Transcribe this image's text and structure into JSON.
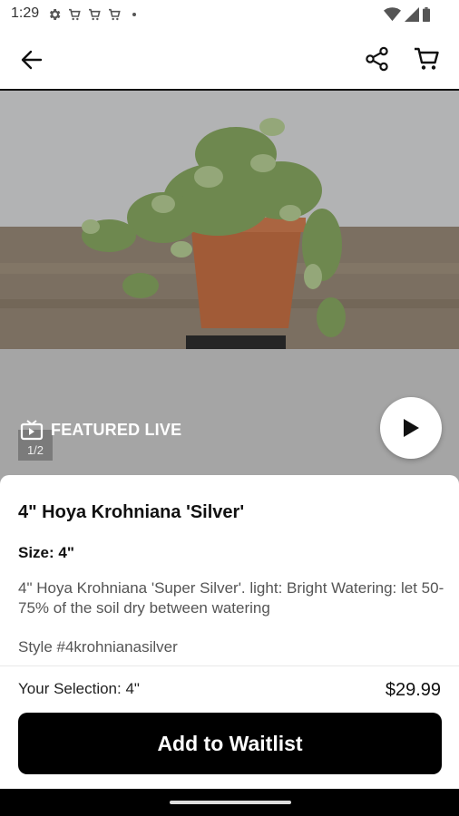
{
  "status_bar": {
    "time": "1:29",
    "left_icons": [
      "gear-icon",
      "cart-notification-icon",
      "cart-notification-icon",
      "cart-notification-icon",
      "dot"
    ],
    "right_icons": [
      "wifi-icon",
      "signal-icon",
      "battery-icon"
    ]
  },
  "app_bar": {
    "icons": [
      "back-arrow-icon",
      "share-icon",
      "cart-icon"
    ]
  },
  "hero": {
    "badge_label": "FEATURED LIVE",
    "pager": "1/2",
    "play_icon": "play-icon"
  },
  "product": {
    "title": "4\" Hoya Krohniana 'Silver'",
    "size_label": "Size: 4\"",
    "description": "4\" Hoya Krohniana 'Super Silver'. light: Bright Watering: let 50-75% of the soil dry between watering",
    "style": "Style #4krohnianasilver",
    "selection": "Your Selection: 4\"",
    "price": "$29.99",
    "cta_label": "Add to Waitlist"
  },
  "colors": {
    "accent": "#000000",
    "hero_background": "#a5a5a5",
    "pot": "#b8683f"
  }
}
